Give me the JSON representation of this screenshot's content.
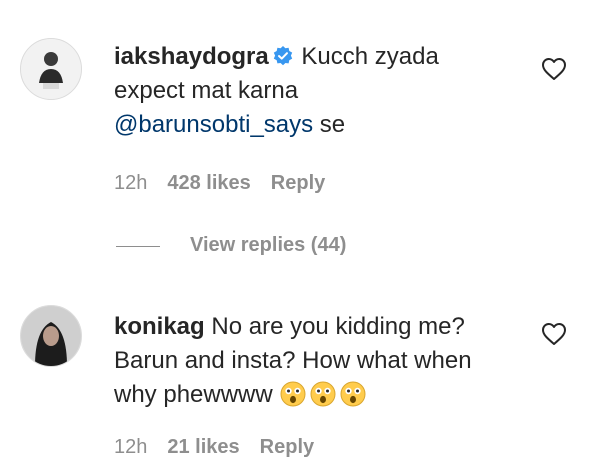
{
  "comments": [
    {
      "username": "iakshaydogra",
      "verified": true,
      "text_line1": "Kucch zyada",
      "text_line2": "expect mat karna",
      "mention": "@barunsobti_says",
      "text_after_mention": " se",
      "time": "12h",
      "likes": "428 likes",
      "reply": "Reply",
      "view_replies": "View replies (44)"
    },
    {
      "username": "konikag",
      "text_line1": "No are you kidding me?",
      "text_line2": "Barun and insta? How what when",
      "text_line3": "why phewwww",
      "emoji": "astonished-face-emoji",
      "emoji_count": 3,
      "time": "12h",
      "likes": "21 likes",
      "reply": "Reply"
    }
  ],
  "icons": {
    "like": "heart-outline-icon",
    "verified": "verified-badge-icon"
  },
  "colors": {
    "text": "#262626",
    "meta": "#8e8e8e",
    "mention": "#00376b",
    "verified": "#3897f0"
  }
}
